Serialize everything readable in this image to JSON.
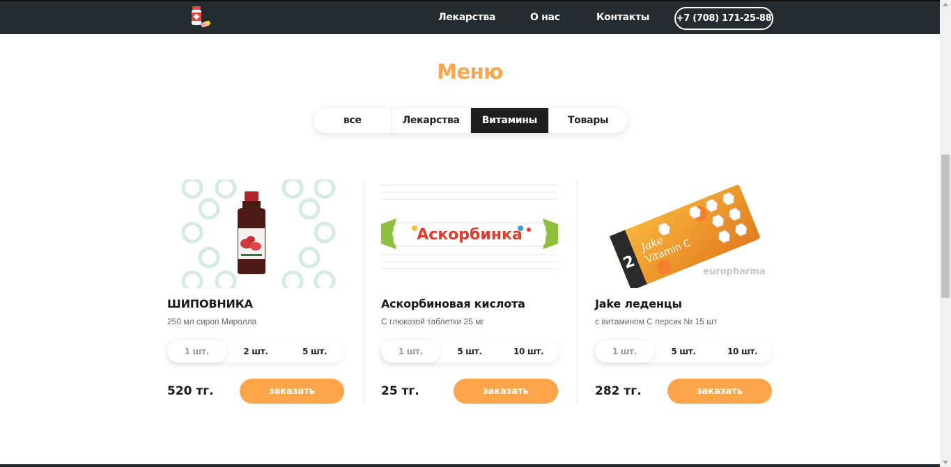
{
  "header": {
    "nav": [
      "Лекарства",
      "О нас",
      "Контакты"
    ],
    "phone": "+7 (708) 171-25-88"
  },
  "section_title": "Меню",
  "tabs": [
    {
      "label": "все",
      "active": false
    },
    {
      "label": "Лекарства",
      "active": false
    },
    {
      "label": "Витамины",
      "active": true
    },
    {
      "label": "Товары",
      "active": false
    }
  ],
  "products": [
    {
      "name": "ШИПОВНИКА",
      "description": "250 мл сироп Миролла",
      "quantities": [
        "1 шт.",
        "2 шт.",
        "5 шт."
      ],
      "selected_quantity": "1 шт.",
      "price": "520 тг.",
      "order_label": "заказать"
    },
    {
      "name": "Аскорбиновая кислота",
      "description": "С глюкозой таблетки 25 мг",
      "quantities": [
        "1 шт.",
        "5 шт.",
        "10 шт."
      ],
      "selected_quantity": "1 шт.",
      "price": "25 тг.",
      "order_label": "заказать"
    },
    {
      "name": "Jake леденцы",
      "description": "с витамином С персик № 15 шт",
      "quantities": [
        "1 шт.",
        "5 шт.",
        "10 шт."
      ],
      "selected_quantity": "1 шт.",
      "price": "282 тг.",
      "order_label": "заказать"
    }
  ],
  "images": {
    "askorbinka_label": "Аскорбинка",
    "jake_brand": "Jake",
    "jake_vitamin": "Vitamin C",
    "jake_pack_number": "2",
    "europharma": "europharma"
  },
  "colors": {
    "accent": "#fba44a",
    "header_bg": "#262b30",
    "active_tab_bg": "#1f1f1f"
  }
}
